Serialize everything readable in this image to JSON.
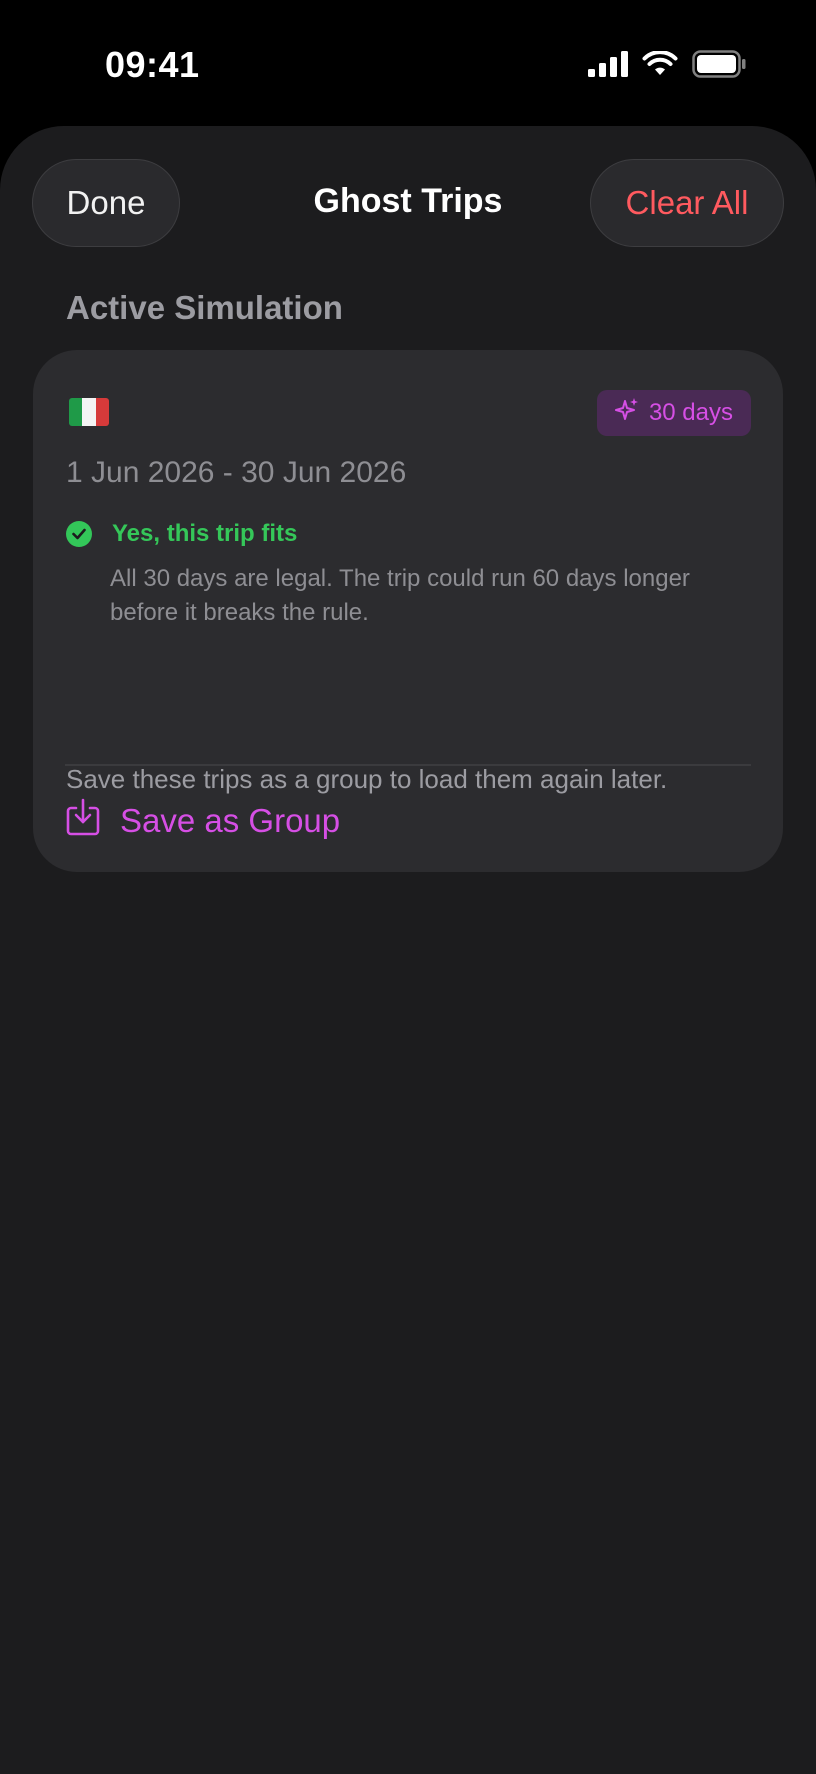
{
  "status": {
    "time": "09:41",
    "icons": [
      "signal-icon",
      "wifi-icon",
      "battery-icon"
    ]
  },
  "nav": {
    "done_label": "Done",
    "title": "Ghost Trips",
    "clear_label": "Clear All"
  },
  "section": {
    "header": "Active Simulation"
  },
  "trip": {
    "flag": "italy-flag-icon",
    "badge_icon": "sparkle-icon",
    "badge_label": "30 days",
    "date_range": "1 Jun 2026 - 30 Jun 2026",
    "fit_title": "Yes, this trip fits",
    "fit_desc": "All 30 days are legal. The trip could run 60 days longer before it breaks the rule.",
    "save_label": "Save as Group"
  },
  "footer": {
    "note": "Save these trips as a group to load them again later."
  },
  "colors": {
    "accent": "#d64fe5",
    "success": "#35c759",
    "danger": "#ff5a5f",
    "sheet_bg": "#1c1c1e",
    "card_bg": "#2c2c2f"
  }
}
